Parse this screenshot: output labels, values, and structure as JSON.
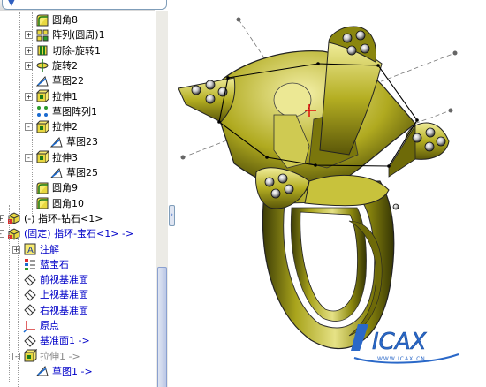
{
  "tree": {
    "items": [
      {
        "label": "圆角8",
        "icon": "fillet-icon",
        "depth": 2,
        "expander": "",
        "style": ""
      },
      {
        "label": "阵列(圆周)1",
        "icon": "circular-pattern-icon",
        "depth": 2,
        "expander": "+",
        "style": ""
      },
      {
        "label": "切除-旋转1",
        "icon": "revolve-cut-icon",
        "depth": 2,
        "expander": "+",
        "style": ""
      },
      {
        "label": "旋转2",
        "icon": "revolve-icon",
        "depth": 2,
        "expander": "+",
        "style": ""
      },
      {
        "label": "草图22",
        "icon": "sketch-icon",
        "depth": 2,
        "expander": "",
        "style": ""
      },
      {
        "label": "拉伸1",
        "icon": "extrude-icon",
        "depth": 2,
        "expander": "+",
        "style": ""
      },
      {
        "label": "草图阵列1",
        "icon": "sketch-pattern-icon",
        "depth": 2,
        "expander": "",
        "style": ""
      },
      {
        "label": "拉伸2",
        "icon": "extrude-icon",
        "depth": 2,
        "expander": "-",
        "style": ""
      },
      {
        "label": "草图23",
        "icon": "sketch-icon",
        "depth": 3,
        "expander": "",
        "style": ""
      },
      {
        "label": "拉伸3",
        "icon": "extrude-icon",
        "depth": 2,
        "expander": "-",
        "style": ""
      },
      {
        "label": "草图25",
        "icon": "sketch-icon",
        "depth": 3,
        "expander": "",
        "style": ""
      },
      {
        "label": "圆角9",
        "icon": "fillet-icon",
        "depth": 2,
        "expander": "",
        "style": ""
      },
      {
        "label": "圆角10",
        "icon": "fillet-icon",
        "depth": 2,
        "expander": "",
        "style": ""
      },
      {
        "label": "(-) 指环-钻石<1>",
        "icon": "part-icon",
        "depth": 0,
        "expander": "+",
        "style": ""
      },
      {
        "label": "(固定) 指环-宝石<1> ->",
        "icon": "part-icon",
        "depth": 0,
        "expander": "-",
        "style": "blue"
      },
      {
        "label": "注解",
        "icon": "annotation-icon",
        "depth": 1,
        "expander": "+",
        "style": "blue"
      },
      {
        "label": "蓝宝石",
        "icon": "material-icon",
        "depth": 1,
        "expander": "",
        "style": "blue"
      },
      {
        "label": "前视基准面",
        "icon": "plane-icon",
        "depth": 1,
        "expander": "",
        "style": "blue"
      },
      {
        "label": "上视基准面",
        "icon": "plane-icon",
        "depth": 1,
        "expander": "",
        "style": "blue"
      },
      {
        "label": "右视基准面",
        "icon": "plane-icon",
        "depth": 1,
        "expander": "",
        "style": "blue"
      },
      {
        "label": "原点",
        "icon": "origin-icon",
        "depth": 1,
        "expander": "",
        "style": "blue"
      },
      {
        "label": "基准面1 ->",
        "icon": "plane-icon",
        "depth": 1,
        "expander": "",
        "style": "blue"
      },
      {
        "label": "拉伸1 ->",
        "icon": "extrude-icon",
        "depth": 1,
        "expander": "-",
        "style": "gray"
      },
      {
        "label": "草图1 ->",
        "icon": "sketch-icon",
        "depth": 2,
        "expander": "",
        "style": "blue"
      }
    ]
  },
  "logo": {
    "main": "ICAX",
    "sub": "WWW.ICAX.CN"
  },
  "colors": {
    "gold": "#a8a41a",
    "gold_dark": "#4a4a06",
    "gold_light": "#e8e690",
    "brand_blue": "#2a68c8"
  }
}
